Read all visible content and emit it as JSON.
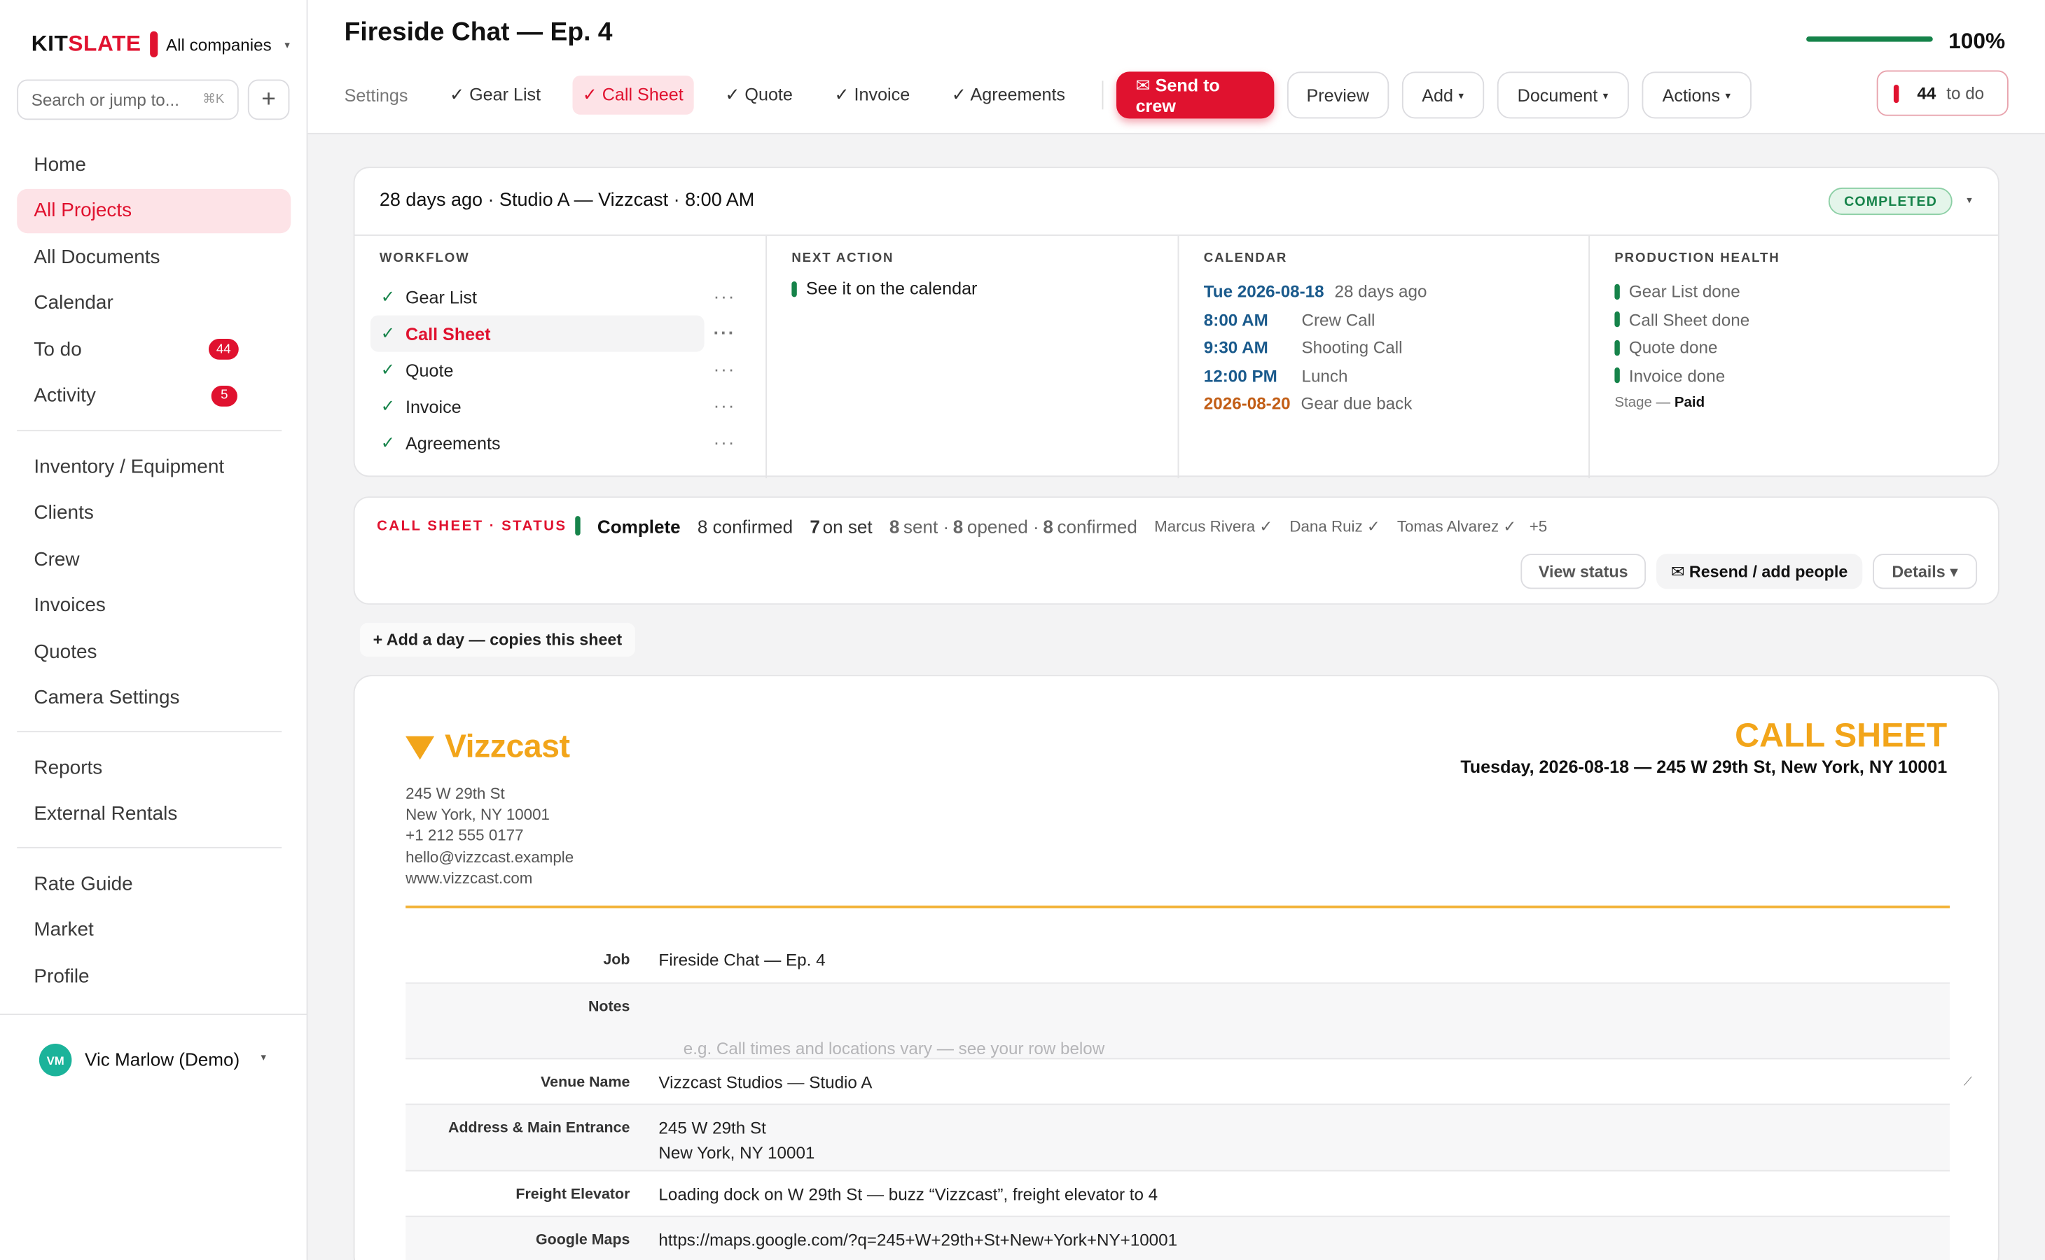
{
  "brand": {
    "name_part1": "KIT",
    "name_part2": "SLATE",
    "company": "All companies"
  },
  "search": {
    "placeholder": "Search or jump to...",
    "shortcut": "⌘K"
  },
  "nav": {
    "primary": [
      {
        "label": "Home"
      },
      {
        "label": "All Projects",
        "active": true
      },
      {
        "label": "All Documents"
      },
      {
        "label": "Calendar"
      },
      {
        "label": "To do",
        "badge": "44"
      },
      {
        "label": "Activity",
        "badge": "5"
      }
    ],
    "secondary": [
      "Inventory / Equipment",
      "Clients",
      "Crew",
      "Invoices",
      "Quotes",
      "Camera Settings"
    ],
    "tertiary": [
      "Reports",
      "External Rentals"
    ],
    "quaternary": [
      "Rate Guide",
      "Market",
      "Profile"
    ]
  },
  "user": {
    "initials": "VM",
    "name": "Vic Marlow (Demo)"
  },
  "header": {
    "title": "Fireside Chat — Ep. 4",
    "progress_label": "100%",
    "progress_value": 1.0,
    "tabs": [
      "Settings",
      "✓ Gear List",
      "✓ Call Sheet",
      "✓ Quote",
      "✓ Invoice",
      "✓ Agreements"
    ],
    "active_tab": "✓ Call Sheet",
    "send_label": "✉ Send to crew",
    "preview_label": "Preview",
    "add_label": "Add",
    "document_label": "Document",
    "actions_label": "Actions",
    "todo_count": "44",
    "todo_label": "to do"
  },
  "overview": {
    "headline": "28 days ago · Studio A — Vizzcast · 8:00 AM",
    "status": "COMPLETED",
    "workflow_heading": "WORKFLOW",
    "workflow": [
      "Gear List",
      "Call Sheet",
      "Quote",
      "Invoice",
      "Agreements"
    ],
    "workflow_active": "Call Sheet",
    "next_action_heading": "NEXT ACTION",
    "next_action": "See it on the calendar",
    "calendar_heading": "CALENDAR",
    "calendar": [
      {
        "when": "Tue 2026-08-18",
        "what": "28 days ago"
      },
      {
        "when": "8:00 AM",
        "what": "Crew Call"
      },
      {
        "when": "9:30 AM",
        "what": "Shooting Call"
      },
      {
        "when": "12:00 PM",
        "what": "Lunch"
      },
      {
        "when": "2026-08-20",
        "what": "Gear due back"
      }
    ],
    "health_heading": "PRODUCTION HEALTH",
    "health": [
      "Gear List done",
      "Call Sheet done",
      "Quote done",
      "Invoice done"
    ],
    "stage_label": "Stage —",
    "stage_value": "Paid"
  },
  "callsheet_status": {
    "label": "CALL SHEET · STATUS",
    "complete": "Complete",
    "confirmed": "8 confirmed",
    "on_set_num": "7",
    "on_set_label": "on set",
    "sent_num": "8",
    "sent_label": "sent ·",
    "opened_num": "8",
    "opened_label": "opened ·",
    "confirmed_num": "8",
    "confirmed_label": "confirmed",
    "people": [
      "Marcus Rivera ✓",
      "Dana Ruiz ✓",
      "Tomas Alvarez ✓"
    ],
    "more": "+5",
    "view_label": "View status",
    "resend_label": "✉ Resend / add people",
    "details_label": "Details ▾"
  },
  "add_day": "+ Add a day — copies this sheet",
  "document": {
    "company": "Vizzcast",
    "address": [
      "245 W 29th St",
      "New York, NY 10001",
      "+1 212 555 0177",
      "hello@vizzcast.example",
      "www.vizzcast.com"
    ],
    "title": "CALL SHEET",
    "subtitle": "Tuesday, 2026-08-18 — 245 W 29th St, New York, NY 10001",
    "fields": [
      {
        "label": "Job",
        "value": "Fireside Chat — Ep. 4"
      },
      {
        "label": "Notes",
        "placeholder": "e.g. Call times and locations vary — see your row below"
      },
      {
        "label": "Venue Name",
        "value": "Vizzcast Studios — Studio A"
      },
      {
        "label": "Address & Main Entrance",
        "value_line1": "245 W 29th St",
        "value_line2": "New York, NY 10001"
      },
      {
        "label": "Freight Elevator",
        "value": "Loading dock on W 29th St — buzz “Vizzcast”, freight elevator to 4"
      },
      {
        "label": "Google Maps",
        "value": "https://maps.google.com/?q=245+W+29th+St+New+York+NY+10001"
      }
    ]
  },
  "colors": {
    "accent": "#e0122f",
    "success": "#16834a",
    "brand_doc": "#f2a51a",
    "calendar_blue": "#1a5a8c",
    "calendar_orange": "#c25e16"
  }
}
